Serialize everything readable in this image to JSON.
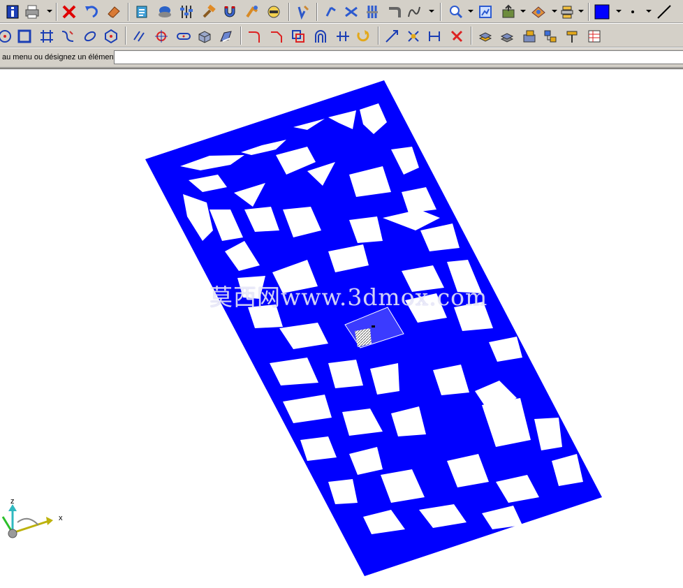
{
  "toolbar_top": {
    "tools": [
      "info-icon",
      "printer-icon",
      "delete-icon",
      "undo-icon",
      "eraser-icon",
      "macro-icon",
      "zoom-window-icon",
      "sliders-icon",
      "hammer-icon",
      "magnet-icon",
      "snap-icon",
      "view-icon",
      "edit-point-icon",
      "rotate-icon",
      "trim-icon",
      "adjust-icon",
      "bend-icon",
      "curve-icon",
      "zoom-icon",
      "fit-icon",
      "import-icon",
      "render-icon",
      "layers-icon",
      "color-swatch",
      "point-style-icon",
      "line-style-icon"
    ],
    "current_color": "#0000ff"
  },
  "toolbar_bottom": {
    "tools": [
      "circle-icon",
      "rectangle-icon",
      "frame-icon",
      "spline-icon",
      "ellipse-icon",
      "polygon-icon",
      "parallel-icon",
      "target-icon",
      "slot-icon",
      "box-icon",
      "sweep-icon",
      "fillet-icon",
      "chamfer-icon",
      "offset-icon",
      "arch-icon",
      "extend-icon",
      "rotate-object-icon",
      "scale-icon",
      "stretch-icon",
      "dimension-icon",
      "cut-icon",
      "extrude-icon",
      "surface-icon",
      "solid-icon",
      "assembly-icon",
      "paint-icon",
      "table-icon"
    ]
  },
  "command": {
    "prompt": "au menu ou désignez un élément:",
    "value": ""
  },
  "viewport": {
    "watermark": "莫西网www.3dmox.com",
    "panel_color": "#0000ff",
    "axes": {
      "x": "x",
      "z": "z"
    }
  }
}
